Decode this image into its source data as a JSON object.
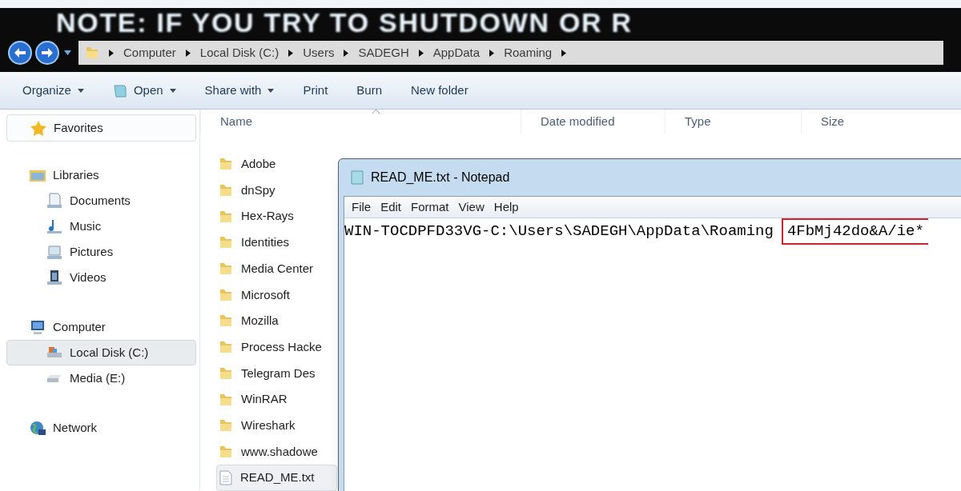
{
  "banner": {
    "text": "NOTE: IF YOU TRY TO SHUTDOWN OR R"
  },
  "breadcrumb": [
    "Computer",
    "Local Disk (C:)",
    "Users",
    "SADEGH",
    "AppData",
    "Roaming"
  ],
  "toolbar": [
    {
      "label": "Organize",
      "kind": "menu"
    },
    {
      "label": "Open",
      "kind": "open"
    },
    {
      "label": "Share with",
      "kind": "menu"
    },
    {
      "label": "Print",
      "kind": "plain"
    },
    {
      "label": "Burn",
      "kind": "plain"
    },
    {
      "label": "New folder",
      "kind": "plain"
    }
  ],
  "sidebar": [
    {
      "label": "Favorites",
      "kind": "favorites",
      "selected": false
    },
    {
      "label": "Libraries",
      "kind": "libraries",
      "selected": false,
      "children": [
        {
          "label": "Documents",
          "kind": "documents",
          "selected": false
        },
        {
          "label": "Music",
          "kind": "music",
          "selected": false
        },
        {
          "label": "Pictures",
          "kind": "pictures",
          "selected": false
        },
        {
          "label": "Videos",
          "kind": "videos",
          "selected": false
        }
      ]
    },
    {
      "label": "Computer",
      "kind": "computer",
      "selected": false,
      "children": [
        {
          "label": "Local Disk (C:)",
          "kind": "disk",
          "selected": true
        },
        {
          "label": "Media (E:)",
          "kind": "drive",
          "selected": false
        }
      ]
    },
    {
      "label": "Network",
      "kind": "network",
      "selected": false
    }
  ],
  "columns": [
    "Name",
    "Date modified",
    "Type",
    "Size"
  ],
  "files": [
    {
      "name": "Adobe",
      "kind": "folder",
      "selected": false
    },
    {
      "name": "dnSpy",
      "kind": "folder",
      "selected": false
    },
    {
      "name": "Hex-Rays",
      "kind": "folder",
      "selected": false
    },
    {
      "name": "Identities",
      "kind": "folder",
      "selected": false
    },
    {
      "name": "Media Center",
      "kind": "folder",
      "selected": false
    },
    {
      "name": "Microsoft",
      "kind": "folder",
      "selected": false
    },
    {
      "name": "Mozilla",
      "kind": "folder",
      "selected": false
    },
    {
      "name": "Process Hacke",
      "kind": "folder",
      "selected": false
    },
    {
      "name": "Telegram Des",
      "kind": "folder",
      "selected": false
    },
    {
      "name": "WinRAR",
      "kind": "folder",
      "selected": false
    },
    {
      "name": "Wireshark",
      "kind": "folder",
      "selected": false
    },
    {
      "name": "www.shadowe",
      "kind": "folder",
      "selected": false
    },
    {
      "name": "READ_ME.txt",
      "kind": "text",
      "selected": true
    }
  ],
  "notepad": {
    "title": "READ_ME.txt - Notepad",
    "menu": [
      "File",
      "Edit",
      "Format",
      "View",
      "Help"
    ],
    "text": "WIN-TOCDPFD33VG-C:\\Users\\SADEGH\\AppData\\Roaming",
    "highlighted": "4FbMj42do&A/ie*"
  }
}
